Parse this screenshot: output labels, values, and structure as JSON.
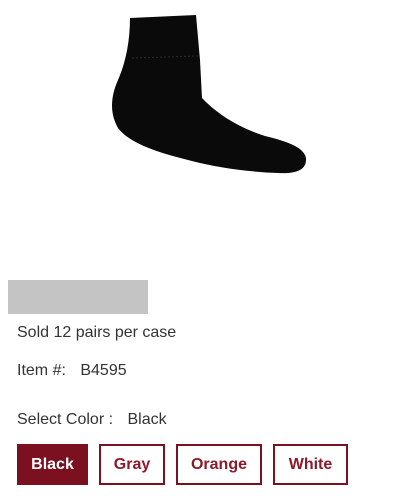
{
  "product": {
    "image_icon": "ankle-sock-image",
    "image_color": "#0a0a0a",
    "sold_text": "Sold 12 pairs per case",
    "item_label": "Item #:",
    "item_number": "B4595",
    "select_color_label": "Select Color :",
    "selected_color": "Black"
  },
  "colors": [
    {
      "label": "Black",
      "selected": true
    },
    {
      "label": "Gray",
      "selected": false
    },
    {
      "label": "Orange",
      "selected": false
    },
    {
      "label": "White",
      "selected": false
    }
  ],
  "theme": {
    "accent": "#7b1020",
    "placeholder": "#c4c4c4"
  }
}
